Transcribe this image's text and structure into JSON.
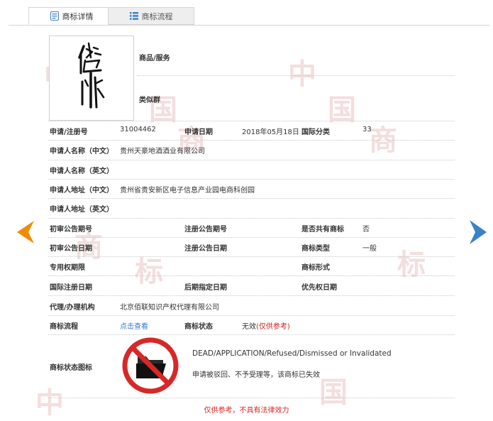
{
  "tabs": [
    {
      "label": "商标详情",
      "active": true,
      "icon": "document-icon"
    },
    {
      "label": "商标流程",
      "active": false,
      "icon": "list-icon"
    }
  ],
  "watermark_chars": [
    "中",
    "国",
    "商",
    "标"
  ],
  "colors": {
    "accent": "#f08c00",
    "next_arrow": "#3a82c8",
    "link": "#3a78c9",
    "warning": "#cc2222"
  },
  "top_fields": {
    "goods_services_label": "商品/服务",
    "similar_group_label": "类似群"
  },
  "fields": {
    "reg_no_label": "申请/注册号",
    "reg_no": "31004462",
    "app_date_label": "申请日期",
    "app_date": "2018年05月18日",
    "intl_class_label": "国际分类",
    "intl_class": "33",
    "applicant_cn_label": "申请人名称（中文）",
    "applicant_cn": "贵州天豪地酒酒业有限公司",
    "applicant_en_label": "申请人名称（英文）",
    "address_cn_label": "申请人地址（中文）",
    "address_cn": "贵州省贵安新区电子信息产业园电商科创园",
    "address_en_label": "申请人地址（英文）",
    "prelim_pub_no_label": "初审公告期号",
    "reg_pub_no_label": "注册公告期号",
    "shared_label": "是否共有商标",
    "shared": "否",
    "prelim_pub_date_label": "初审公告日期",
    "reg_pub_date_label": "注册公告日期",
    "mark_type_label": "商标类型",
    "mark_type": "一般",
    "exclusive_period_label": "专用权期限",
    "mark_form_label": "商标形式",
    "intl_reg_date_label": "国际注册日期",
    "later_designation_label": "后期指定日期",
    "priority_date_label": "优先权日期",
    "agency_label": "代理/办理机构",
    "agency": "北京佰联知识产权代理有限公司",
    "process_label": "商标流程",
    "process_link": "点击查看",
    "status_label": "商标状态",
    "status_value": "无效",
    "status_note": "(仅供参考)",
    "status_icon_label": "商标状态图标"
  },
  "status_detail": {
    "english": "DEAD/APPLICATION/Refused/Dismissed or Invalidated",
    "chinese": "申请被驳回、不予受理等，该商标已失效"
  },
  "footer": "仅供参考，不具有法律效力"
}
